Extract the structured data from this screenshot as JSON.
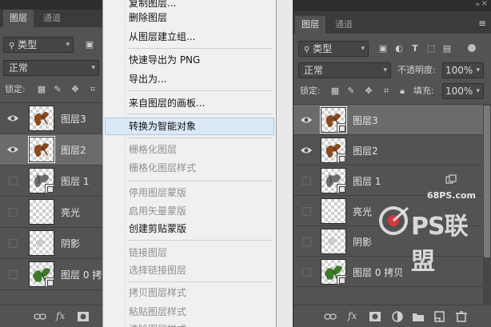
{
  "left_panel": {
    "tabs": [
      {
        "label": "图层",
        "active": true
      },
      {
        "label": "通道",
        "active": false
      }
    ],
    "filter_kind": "类型",
    "blend_mode": "正常",
    "lock_label": "锁定:",
    "layers": [
      {
        "name": "图层3",
        "visible": true,
        "selected": false,
        "smart": false
      },
      {
        "name": "图层2",
        "visible": true,
        "selected": true,
        "smart": false
      },
      {
        "name": "图层 1",
        "visible": false,
        "selected": false,
        "smart": true
      },
      {
        "name": "亮光",
        "visible": false,
        "selected": false,
        "smart": false
      },
      {
        "name": "阴影",
        "visible": false,
        "selected": false,
        "smart": false
      },
      {
        "name": "图层 0 拷",
        "visible": false,
        "selected": false,
        "smart": true
      }
    ],
    "footer_fx": "fx"
  },
  "context_menu": {
    "items": [
      {
        "label": "复制图层...",
        "enabled": true
      },
      {
        "label": "删除图层",
        "enabled": true
      },
      {
        "label": "从图层建立组...",
        "enabled": true
      },
      {
        "label": "快速导出为 PNG",
        "enabled": true
      },
      {
        "label": "导出为...",
        "enabled": true
      },
      {
        "label": "来自图层的画板...",
        "enabled": true
      },
      {
        "label": "转换为智能对象",
        "enabled": true,
        "highlighted": true
      },
      {
        "label": "栅格化图层",
        "enabled": false
      },
      {
        "label": "栅格化图层样式",
        "enabled": false
      },
      {
        "label": "停用图层蒙版",
        "enabled": false
      },
      {
        "label": "启用矢量蒙版",
        "enabled": false
      },
      {
        "label": "创建剪贴蒙版",
        "enabled": true
      },
      {
        "label": "链接图层",
        "enabled": false
      },
      {
        "label": "选择链接图层",
        "enabled": false
      },
      {
        "label": "拷贝图层样式",
        "enabled": false
      },
      {
        "label": "粘贴图层样式",
        "enabled": false
      },
      {
        "label": "清除图层样式",
        "enabled": false
      }
    ]
  },
  "right_panel": {
    "tabs": [
      {
        "label": "图层",
        "active": true
      },
      {
        "label": "通道",
        "active": false
      }
    ],
    "filter_kind": "类型",
    "blend_mode": "正常",
    "opacity_label": "不透明度:",
    "opacity_value": "100%",
    "lock_label": "锁定:",
    "fill_label": "填充:",
    "fill_value": "100%",
    "layers": [
      {
        "name": "图层3",
        "visible": true,
        "selected": true,
        "smart": true
      },
      {
        "name": "图层2",
        "visible": true,
        "selected": false,
        "smart": true
      },
      {
        "name": "图层 1",
        "visible": false,
        "selected": false,
        "smart": true,
        "linked": true
      },
      {
        "name": "亮光",
        "visible": false,
        "selected": false,
        "smart": false
      },
      {
        "name": "阴影",
        "visible": false,
        "selected": false,
        "smart": false
      },
      {
        "name": "图层 0 拷贝",
        "visible": false,
        "selected": false,
        "smart": true
      }
    ],
    "footer_fx": "fx"
  },
  "watermark": {
    "url": "68PS.com",
    "text": "PS联盟"
  }
}
